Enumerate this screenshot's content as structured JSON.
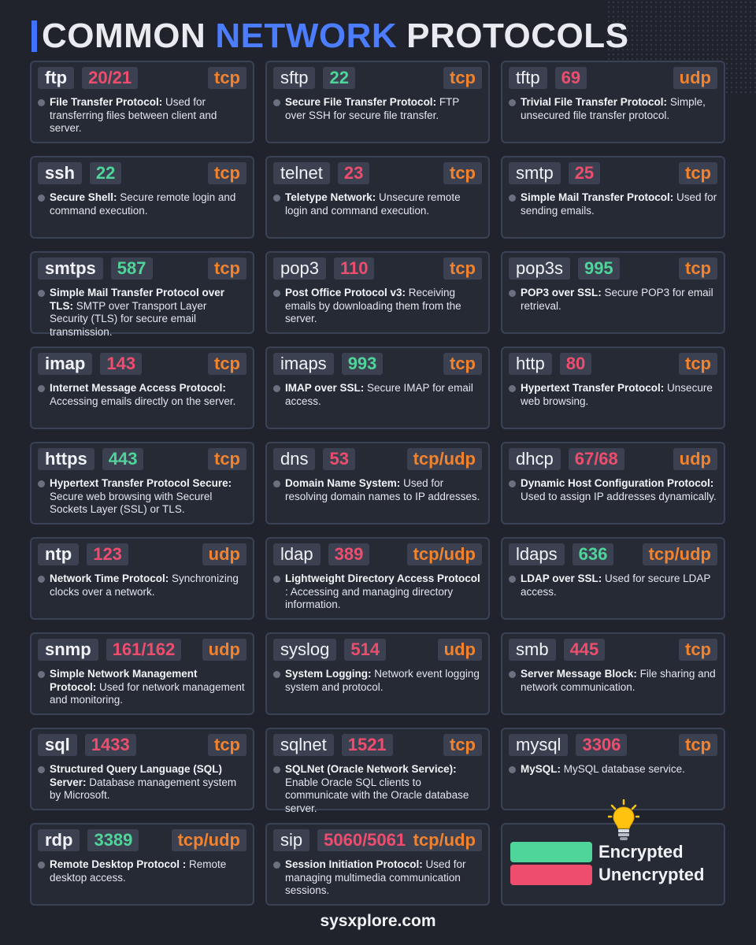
{
  "title": {
    "part1": "COMMON",
    "part2": "NETWORK",
    "part3": "PROTOCOLS"
  },
  "colors": {
    "encrypted": "#4fd49a",
    "unencrypted": "#ee4d6e",
    "protocol": "#f3822c",
    "accent": "#4c7dff"
  },
  "protocols": [
    {
      "name": "ftp",
      "port": "20/21",
      "enc": false,
      "proto": "tcp",
      "term": "File Transfer Protocol:",
      "desc": " Used for transferring files between client and server."
    },
    {
      "name": "sftp",
      "port": "22",
      "enc": true,
      "proto": "tcp",
      "term": "Secure File Transfer Protocol:",
      "desc": "  FTP over SSH for secure file transfer."
    },
    {
      "name": "tftp",
      "port": "69",
      "enc": false,
      "proto": "udp",
      "term": "Trivial File Transfer Protocol:",
      "desc": " Simple, unsecured file transfer protocol."
    },
    {
      "name": "ssh",
      "port": "22",
      "enc": true,
      "proto": "tcp",
      "term": "Secure Shell:",
      "desc": " Secure remote login and command execution."
    },
    {
      "name": "telnet",
      "port": "23",
      "enc": false,
      "proto": "tcp",
      "term": "Teletype Network:",
      "desc": " Unsecure remote login and command execution."
    },
    {
      "name": "smtp",
      "port": "25",
      "enc": false,
      "proto": "tcp",
      "term": "Simple Mail Transfer Protocol:",
      "desc": "  Used for sending emails."
    },
    {
      "name": "smtps",
      "port": "587",
      "enc": true,
      "proto": "tcp",
      "term": "Simple Mail Transfer Protocol over TLS:",
      "desc": " SMTP over Transport Layer Security (TLS) for secure email transmission."
    },
    {
      "name": "pop3",
      "port": "110",
      "enc": false,
      "proto": "tcp",
      "term": "Post Office Protocol v3:",
      "desc": " Receiving emails by downloading them from the server."
    },
    {
      "name": "pop3s",
      "port": "995",
      "enc": true,
      "proto": "tcp",
      "term": "POP3 over SSL:",
      "desc": " Secure POP3 for email retrieval."
    },
    {
      "name": "imap",
      "port": "143",
      "enc": false,
      "proto": "tcp",
      "term": "Internet Message Access Protocol:",
      "desc": " Accessing emails directly on the server."
    },
    {
      "name": "imaps",
      "port": "993",
      "enc": true,
      "proto": "tcp",
      "term": "IMAP over SSL:",
      "desc": " Secure IMAP for email access."
    },
    {
      "name": "http",
      "port": "80",
      "enc": false,
      "proto": "tcp",
      "term": "Hypertext Transfer Protocol:",
      "desc": " Unsecure web browsing."
    },
    {
      "name": "https",
      "port": "443",
      "enc": true,
      "proto": "tcp",
      "term": "Hypertext Transfer Protocol Secure:",
      "desc": " Secure web browsing with Securel Sockets Layer (SSL) or TLS."
    },
    {
      "name": "dns",
      "port": "53",
      "enc": false,
      "proto": "tcp/udp",
      "term": "Domain Name System:",
      "desc": " Used for resolving domain names to IP addresses."
    },
    {
      "name": "dhcp",
      "port": "67/68",
      "enc": false,
      "proto": "udp",
      "term": "Dynamic Host Configuration Protocol:",
      "desc": " Used to assign IP addresses dynamically."
    },
    {
      "name": "ntp",
      "port": "123",
      "enc": false,
      "proto": "udp",
      "term": "Network Time Protocol:",
      "desc": " Synchronizing clocks over a network."
    },
    {
      "name": "ldap",
      "port": "389",
      "enc": false,
      "proto": "tcp/udp",
      "term": "Lightweight Directory Access Protocol",
      "desc": " : Accessing and managing directory information."
    },
    {
      "name": "ldaps",
      "port": "636",
      "enc": true,
      "proto": "tcp/udp",
      "term": "LDAP over SSL:",
      "desc": " Used for secure LDAP access."
    },
    {
      "name": "snmp",
      "port": "161/162",
      "enc": false,
      "proto": "udp",
      "term": "Simple Network Management Protocol:",
      "desc": " Used for network management and monitoring."
    },
    {
      "name": "syslog",
      "port": "514",
      "enc": false,
      "proto": "udp",
      "term": "System Logging:",
      "desc": " Network event logging system and protocol."
    },
    {
      "name": "smb",
      "port": "445",
      "enc": false,
      "proto": "tcp",
      "term": "Server Message Block:",
      "desc": " File sharing and network communication."
    },
    {
      "name": "sql",
      "port": "1433",
      "enc": false,
      "proto": "tcp",
      "term": "Structured Query Language (SQL) Server:",
      "desc": " Database management system by Microsoft."
    },
    {
      "name": "sqlnet",
      "port": "1521",
      "enc": false,
      "proto": "tcp",
      "term": "SQLNet (Oracle Network Service):",
      "desc": " Enable Oracle SQL clients to communicate with the Oracle database server."
    },
    {
      "name": "mysql",
      "port": "3306",
      "enc": false,
      "proto": "tcp",
      "term": "MySQL:",
      "desc": " MySQL database service."
    },
    {
      "name": "rdp",
      "port": "3389",
      "enc": true,
      "proto": "tcp/udp",
      "term": "Remote Desktop Protocol :",
      "desc": " Remote desktop access."
    },
    {
      "name": "sip",
      "port": "5060/5061",
      "enc": false,
      "proto": "tcp/udp",
      "term": "Session Initiation Protocol:",
      "desc": "  Used for managing multimedia communication sessions."
    }
  ],
  "legend": {
    "icon": "lightbulb-icon",
    "encrypted_label": "Encrypted",
    "unencrypted_label": "Unencrypted"
  },
  "footer": "sysxplore.com"
}
